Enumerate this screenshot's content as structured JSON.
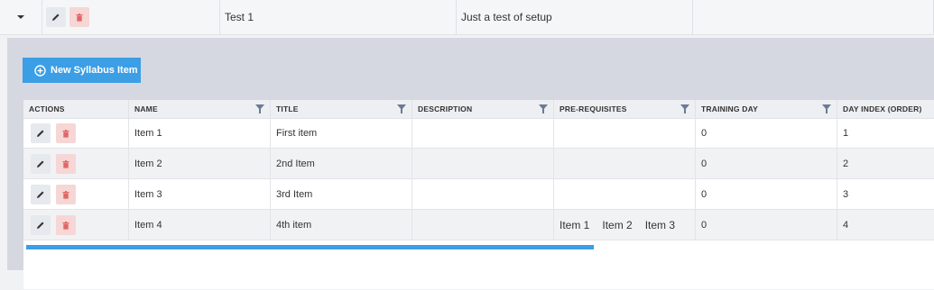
{
  "parent_row": {
    "name": "Test 1",
    "description": "Just a test of setup"
  },
  "toolbar": {
    "new_item_label": "New Syllabus Item",
    "new_item_icon": "plus-circle-icon"
  },
  "grid": {
    "columns": [
      {
        "label": "ACTIONS",
        "filter": false
      },
      {
        "label": "NAME",
        "filter": true
      },
      {
        "label": "TITLE",
        "filter": true
      },
      {
        "label": "DESCRIPTION",
        "filter": true
      },
      {
        "label": "PRE-REQUISITES",
        "filter": true
      },
      {
        "label": "TRAINING DAY",
        "filter": true
      },
      {
        "label": "DAY INDEX (ORDER)",
        "filter": false
      }
    ],
    "rows": [
      {
        "name": "Item 1",
        "title": "First item",
        "description": "",
        "prerequisites": [],
        "training_day": "0",
        "day_index": "1"
      },
      {
        "name": "Item 2",
        "title": "2nd Item",
        "description": "",
        "prerequisites": [],
        "training_day": "0",
        "day_index": "2"
      },
      {
        "name": "Item 3",
        "title": "3rd Item",
        "description": "",
        "prerequisites": [],
        "training_day": "0",
        "day_index": "3"
      },
      {
        "name": "Item 4",
        "title": "4th item",
        "description": "",
        "prerequisites": [
          "Item 1",
          "Item 2",
          "Item 3"
        ],
        "training_day": "0",
        "day_index": "4"
      }
    ]
  },
  "colors": {
    "accent": "#3c9ee5",
    "delete_bg": "#f7d6d6",
    "delete_icon": "#e06767",
    "edit_bg": "#e6e9ee",
    "panel_bg": "#d5d8e1"
  }
}
